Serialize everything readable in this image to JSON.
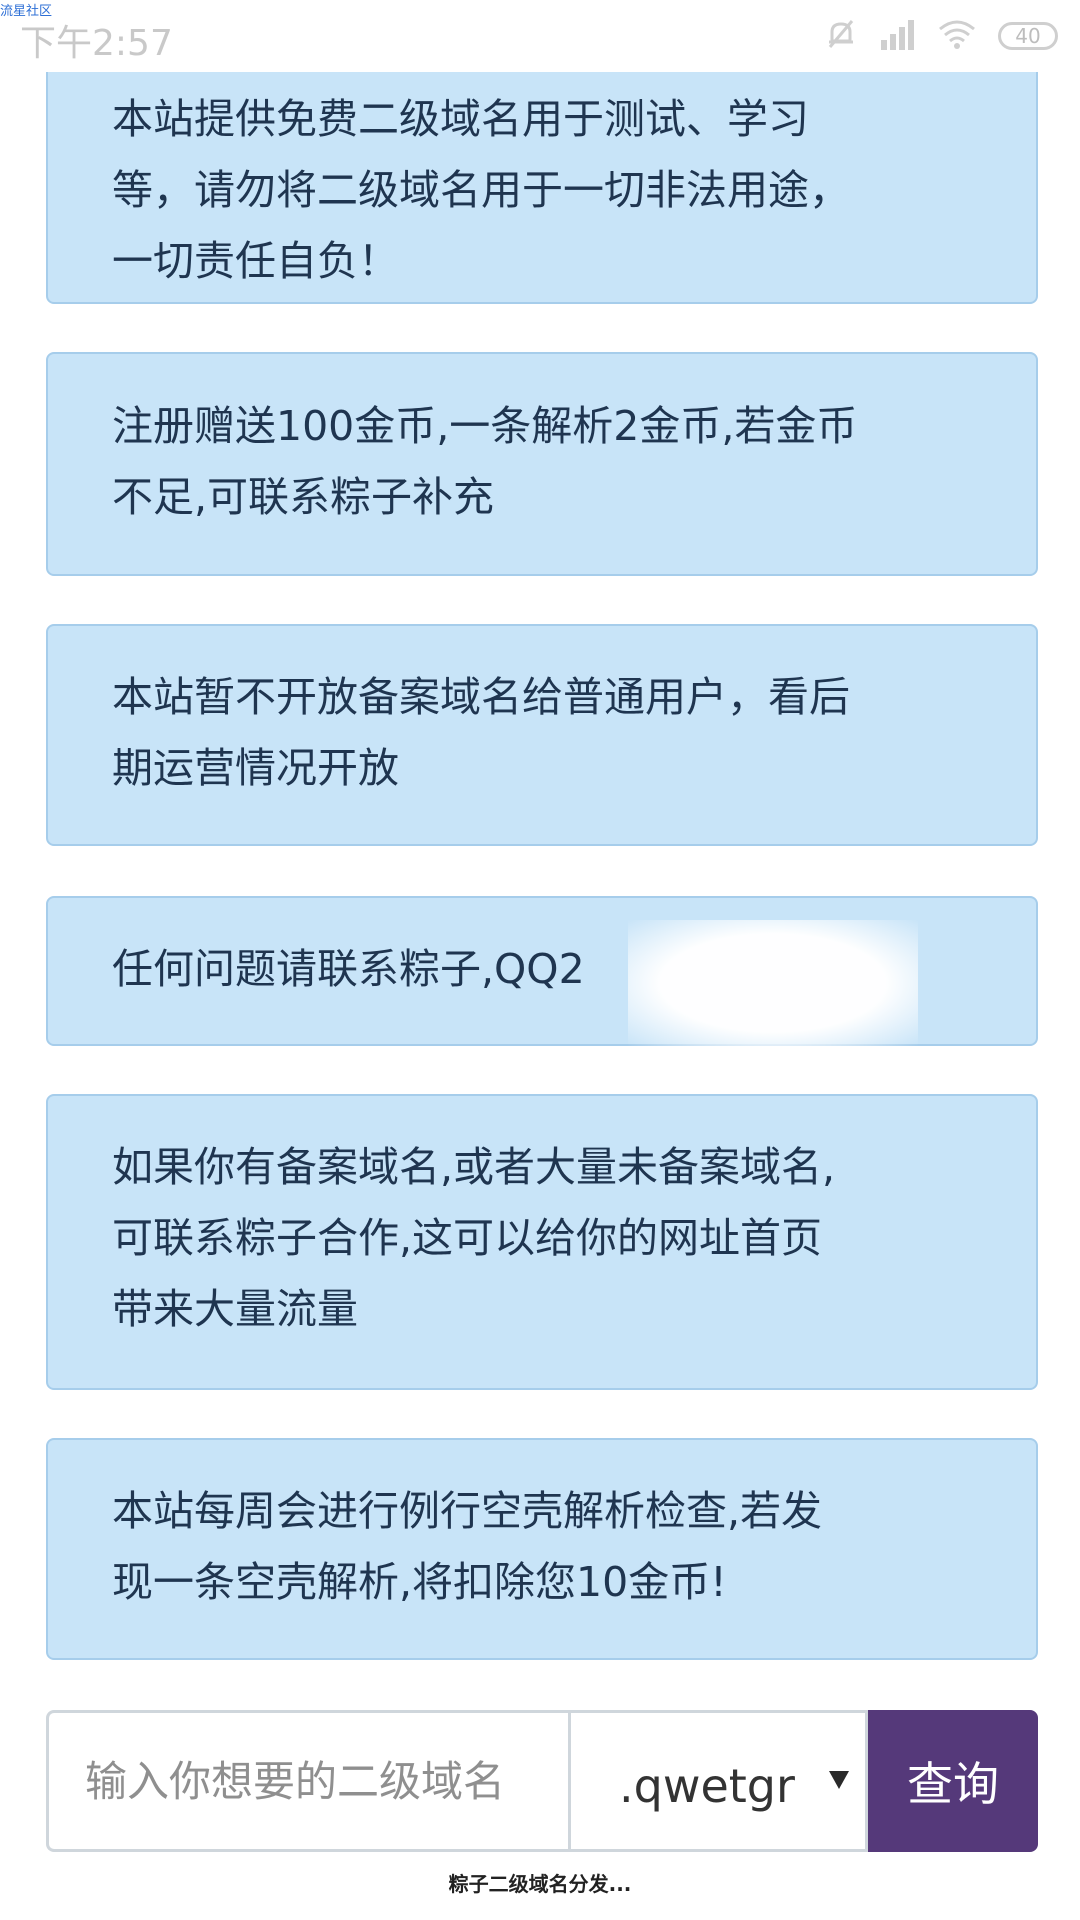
{
  "watermark": "流星社区",
  "status_bar": {
    "time": "下午2:57",
    "battery": "40",
    "icons": [
      "bell-off-icon",
      "signal-icon",
      "wifi-icon",
      "battery-icon"
    ]
  },
  "notices": [
    {
      "lines": [
        "本站提供免费二级域名用于测试、学习",
        "等，请勿将二级域名用于一切非法用途，",
        "一切责任自负！"
      ]
    },
    {
      "lines": [
        "注册赠送100金币,一条解析2金币,若金币",
        "不足,可联系粽子补充"
      ]
    },
    {
      "lines": [
        "本站暂不开放备案域名给普通用户，看后",
        "期运营情况开放"
      ]
    },
    {
      "lines": [
        "任何问题请联系粽子,QQ2"
      ]
    },
    {
      "lines": [
        "如果你有备案域名,或者大量未备案域名,",
        "可联系粽子合作,这可以给你的网址首页",
        "带来大量流量"
      ]
    },
    {
      "lines": [
        "本站每周会进行例行空壳解析检查,若发",
        "现一条空壳解析,将扣除您10金币!"
      ]
    }
  ],
  "search": {
    "placeholder": "输入你想要的二级域名",
    "suffix": ".qwetgr",
    "button_label": "查询"
  },
  "footer": "粽子二级域名分发..."
}
